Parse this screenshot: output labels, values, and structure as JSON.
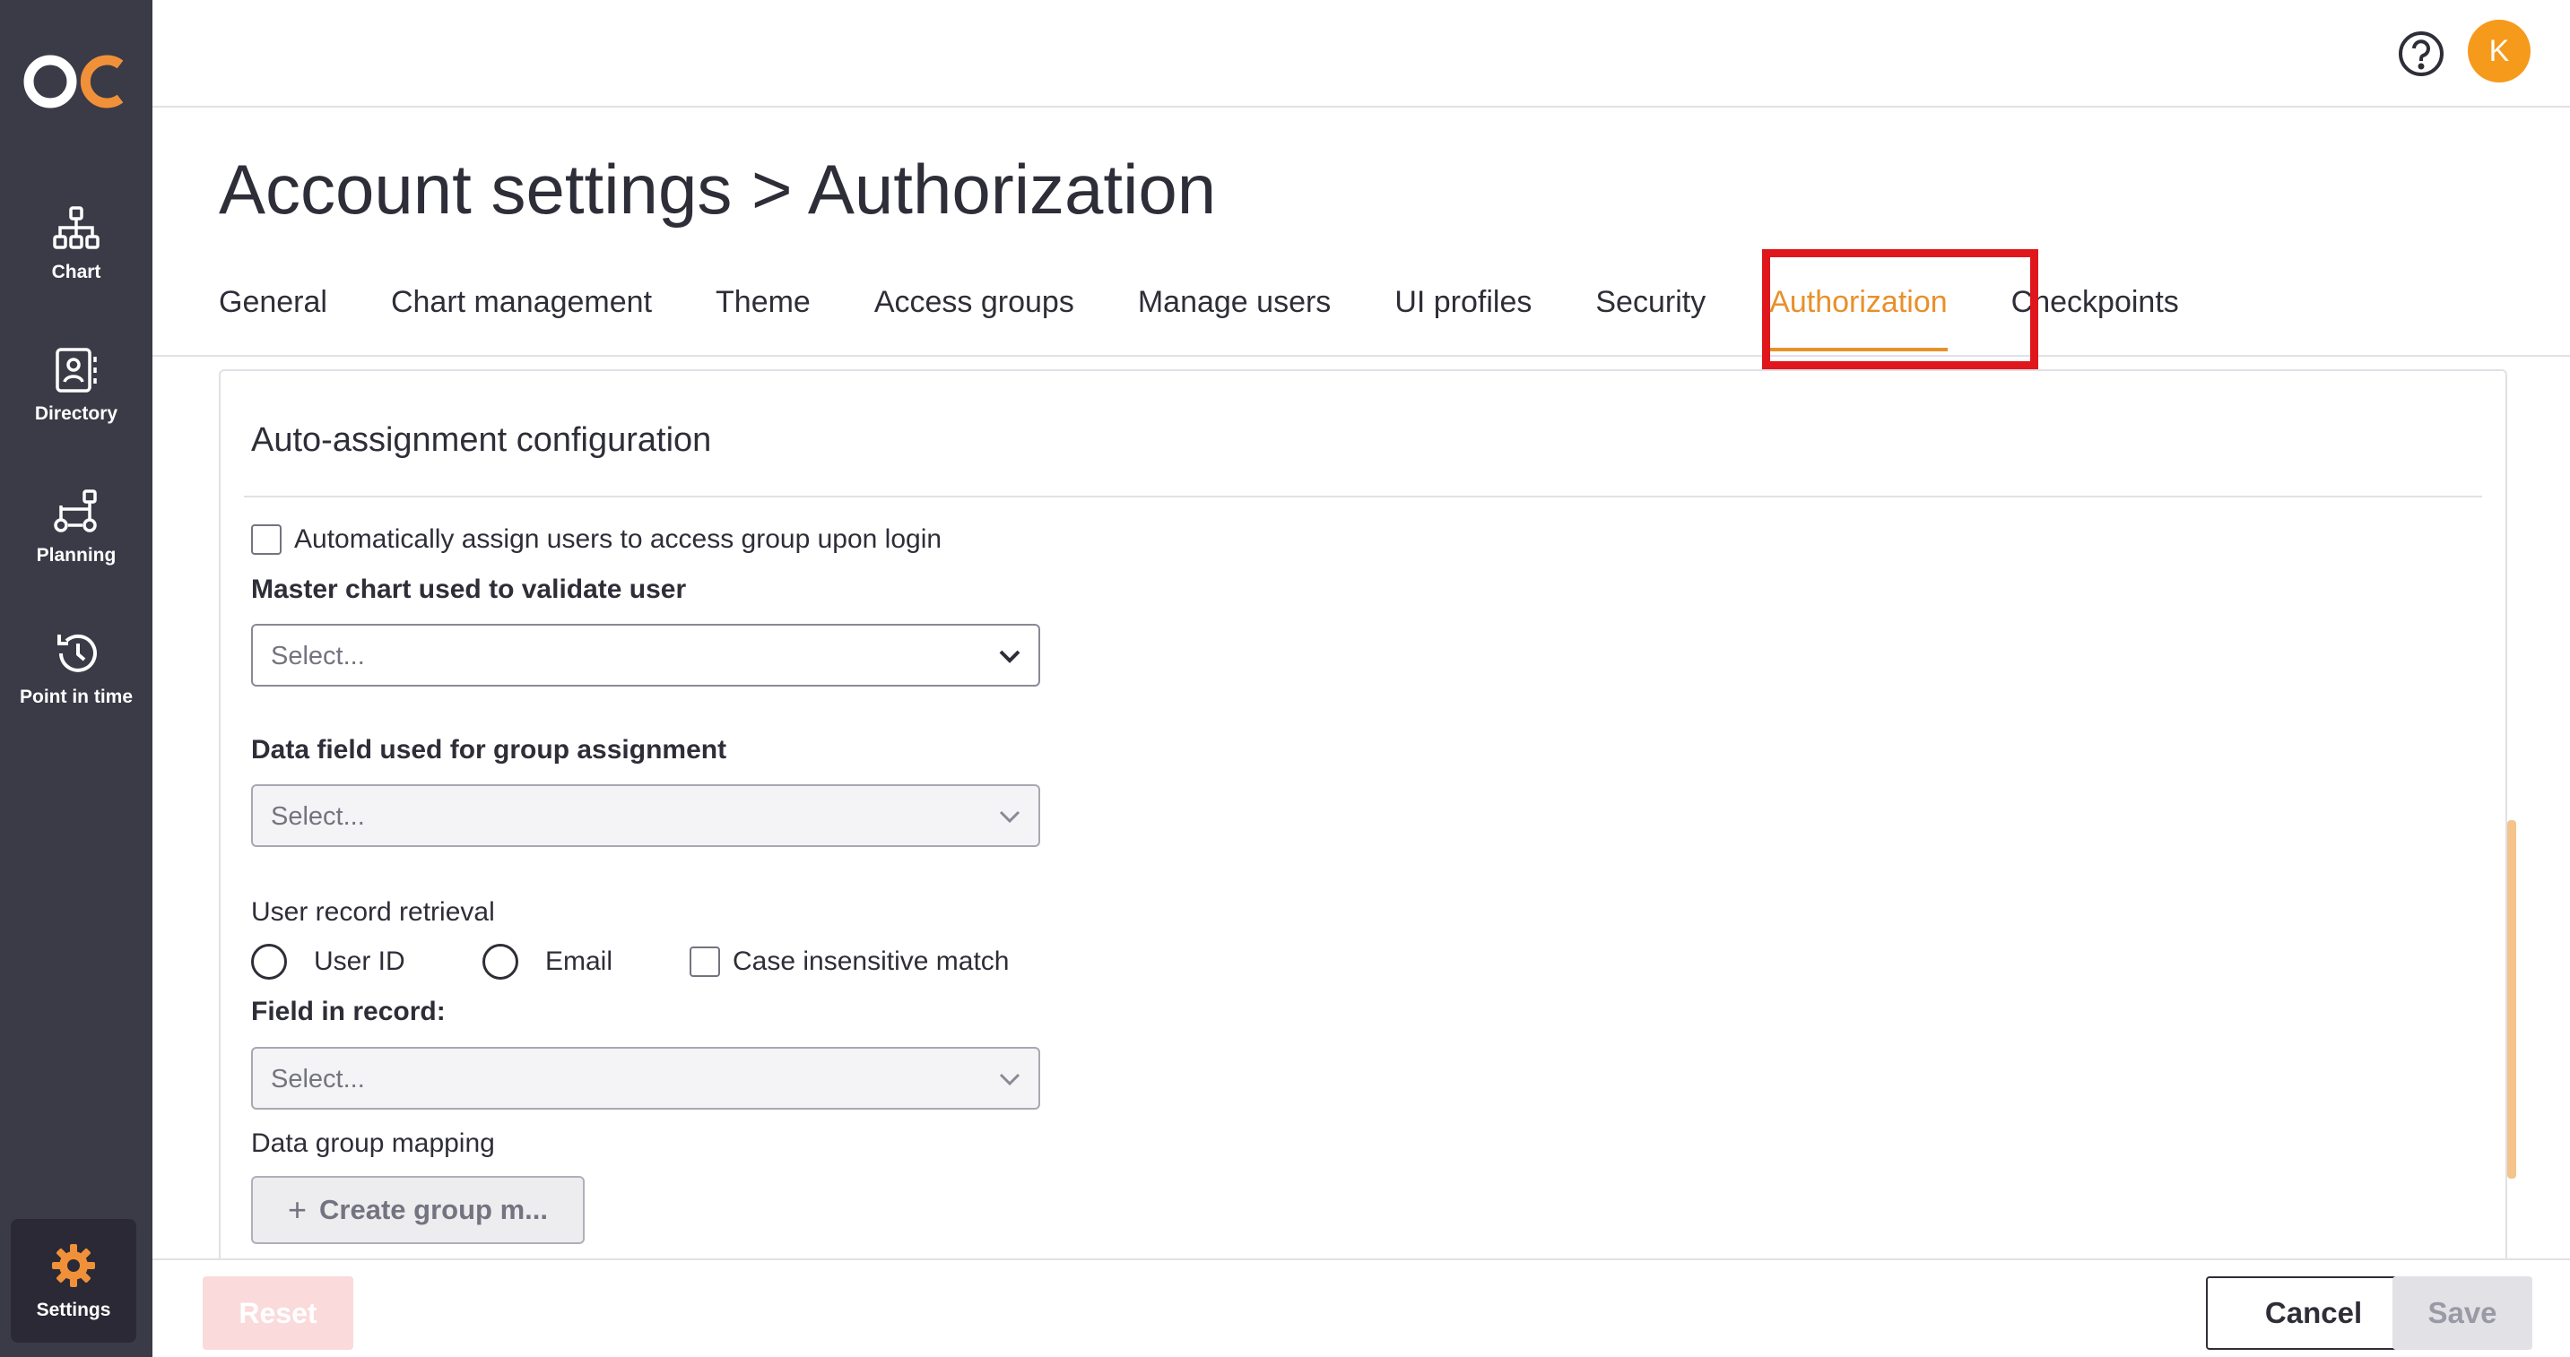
{
  "sidebar": {
    "logo": "OC",
    "items": [
      {
        "label": "Chart",
        "icon": "org-chart-icon"
      },
      {
        "label": "Directory",
        "icon": "directory-icon"
      },
      {
        "label": "Planning",
        "icon": "planning-icon"
      },
      {
        "label": "Point in time",
        "icon": "history-icon"
      }
    ],
    "settings": {
      "label": "Settings",
      "icon": "gear-icon"
    }
  },
  "header": {
    "help_icon": "help-icon",
    "avatar_initial": "K"
  },
  "page": {
    "title": "Account settings > Authorization"
  },
  "tabs": [
    {
      "label": "General"
    },
    {
      "label": "Chart management"
    },
    {
      "label": "Theme"
    },
    {
      "label": "Access groups"
    },
    {
      "label": "Manage users"
    },
    {
      "label": "UI profiles"
    },
    {
      "label": "Security"
    },
    {
      "label": "Authorization",
      "active": true
    },
    {
      "label": "Checkpoints"
    }
  ],
  "form": {
    "section_title": "Auto-assignment configuration",
    "auto_assign_label": "Automatically assign users to access group upon login",
    "master_chart_label": "Master chart used to validate user",
    "master_chart_placeholder": "Select...",
    "data_field_label": "Data field used for group assignment",
    "data_field_placeholder": "Select...",
    "user_record_label": "User record retrieval",
    "radio_user_id": "User ID",
    "radio_email": "Email",
    "case_insensitive_label": "Case insensitive match",
    "field_in_record_label": "Field in record:",
    "field_in_record_placeholder": "Select...",
    "data_group_mapping_label": "Data group mapping",
    "create_group_button": "Create group m..."
  },
  "footer": {
    "reset": "Reset",
    "cancel": "Cancel",
    "save": "Save"
  },
  "colors": {
    "sidebar": "#3b3a47",
    "accent": "#e8902a",
    "highlight": "#e0161d",
    "avatar": "#f59a1b"
  }
}
